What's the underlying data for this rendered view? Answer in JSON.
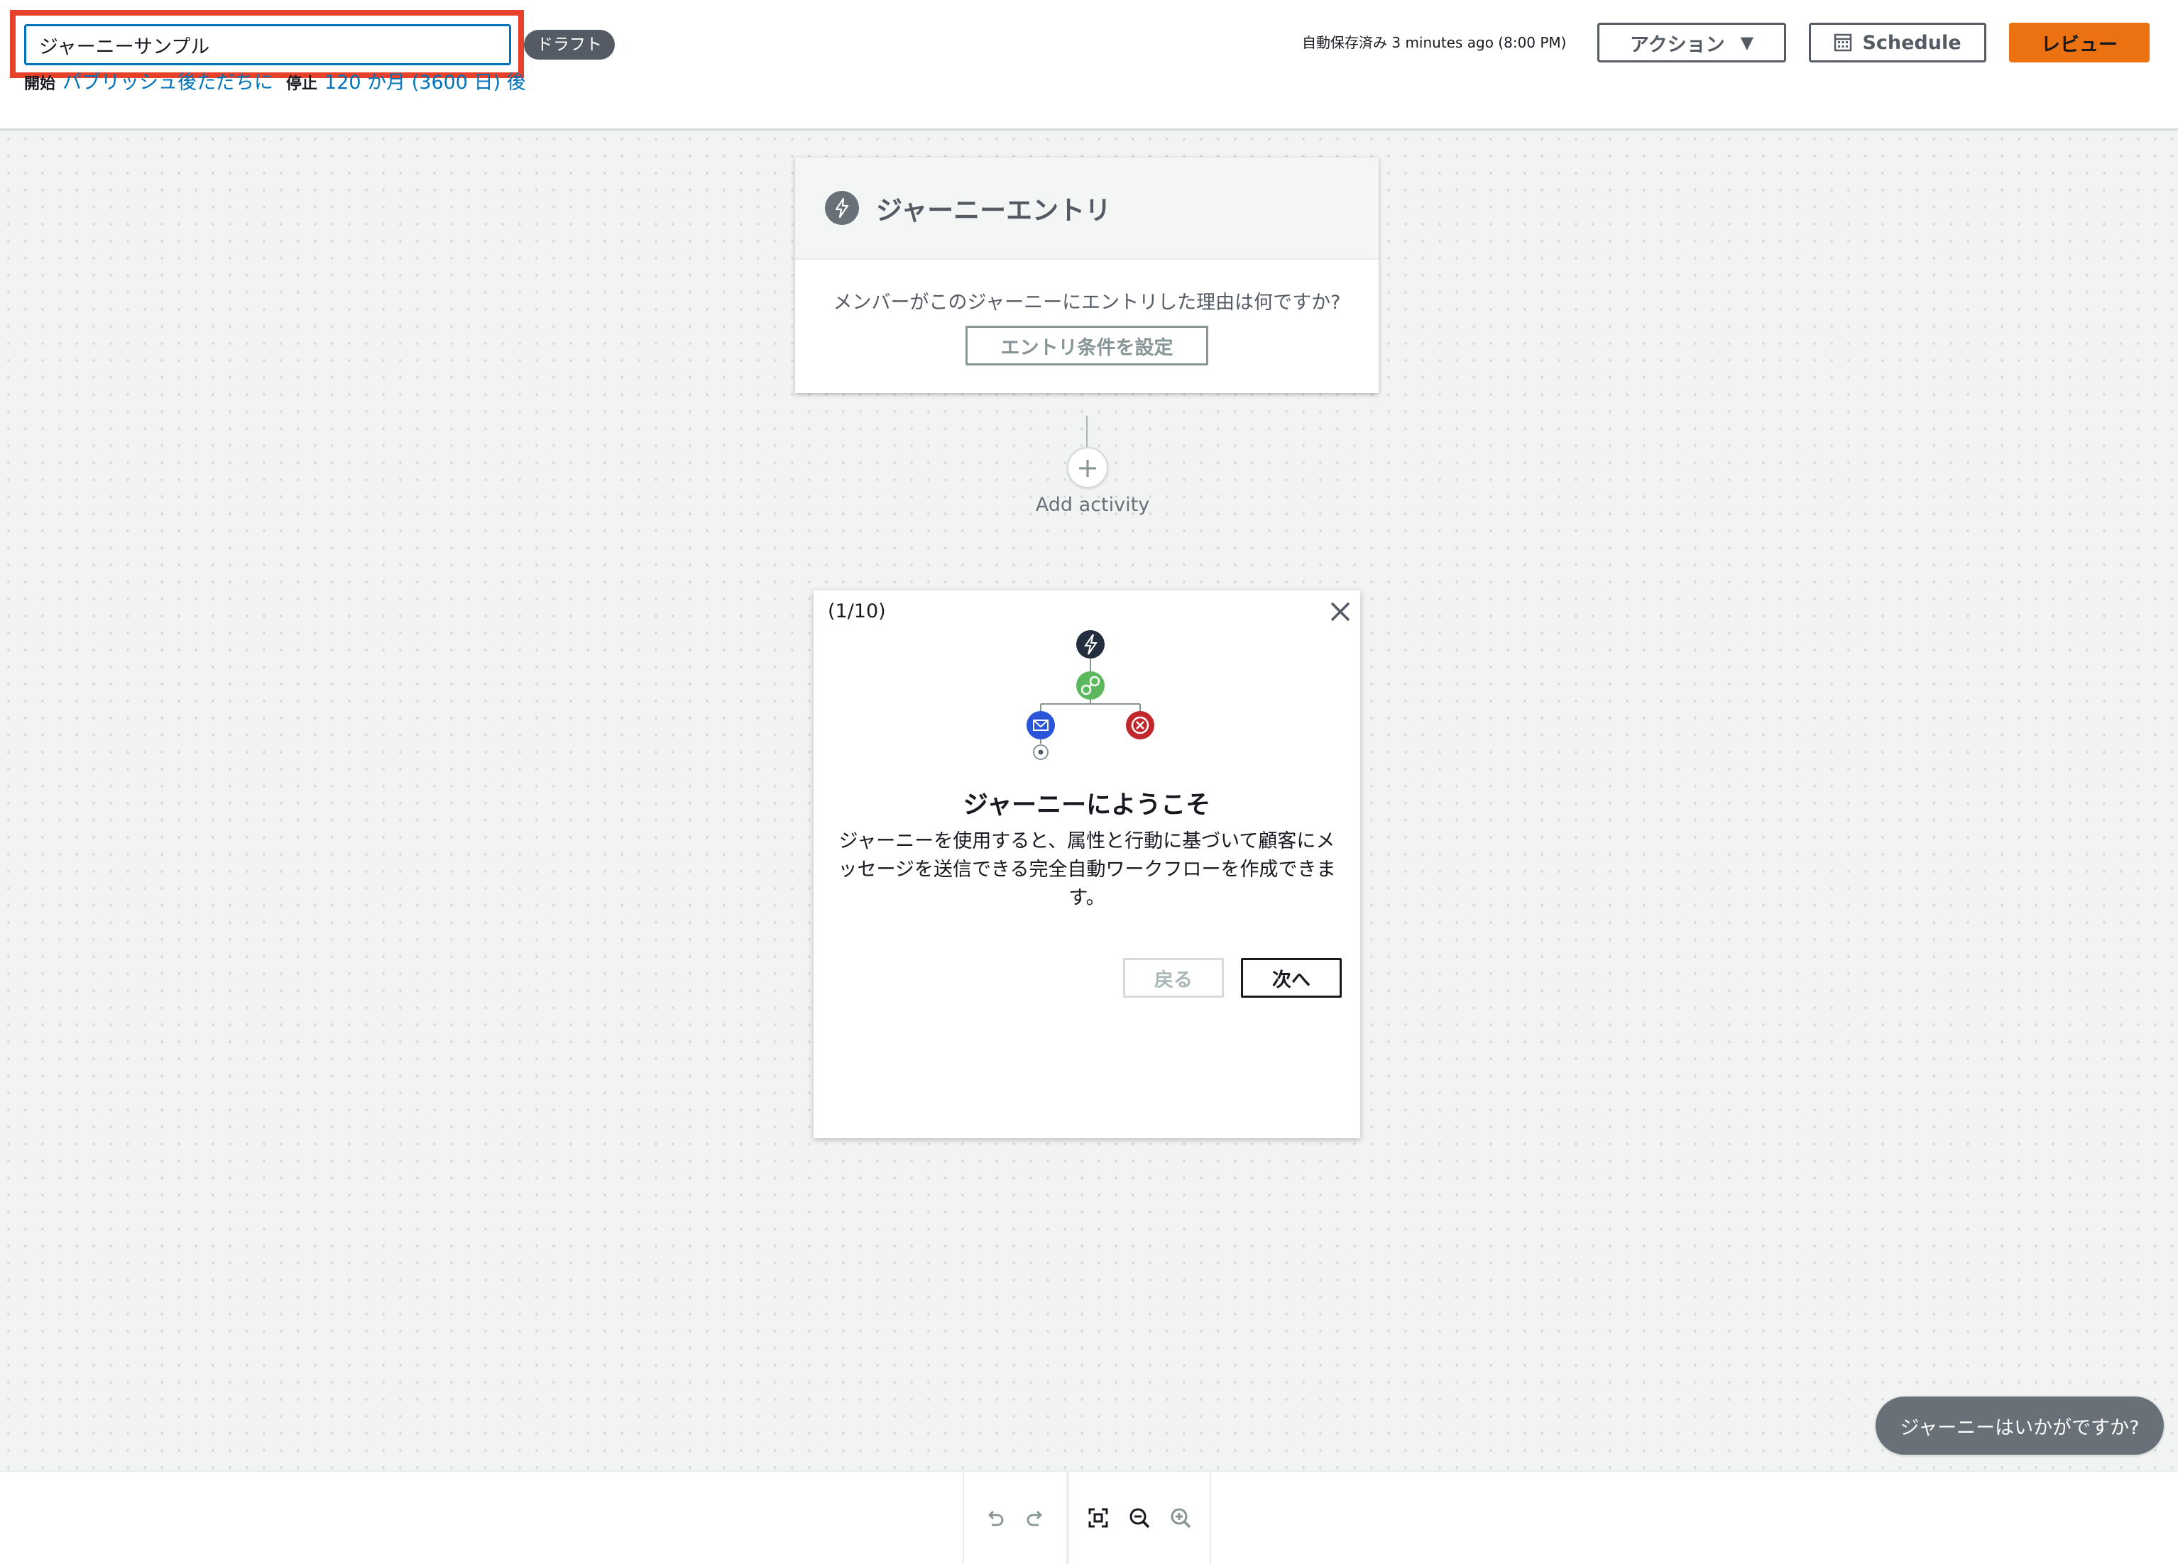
{
  "header": {
    "journey_name": "ジャーニーサンプル",
    "status_badge": "ドラフト",
    "start_label": "開始",
    "start_value": "パブリッシュ後ただちに",
    "stop_label": "停止",
    "stop_value": "120 か月 (3600 日) 後",
    "autosave_text": "自動保存済み 3 minutes ago (8:00 PM)",
    "actions_label": "アクション",
    "schedule_label": "Schedule",
    "review_label": "レビュー"
  },
  "entry_card": {
    "title": "ジャーニーエントリ",
    "question": "メンバーがこのジャーニーにエントリした理由は何ですか?",
    "condition_button": "エントリ条件を設定"
  },
  "add_activity": {
    "symbol": "+",
    "label": "Add activity"
  },
  "tour": {
    "step": "(1/10)",
    "title": "ジャーニーにようこそ",
    "description": "ジャーニーを使用すると、属性と行動に基づいて顧客にメッセージを送信できる完全自動ワークフローを作成できます。",
    "back_label": "戻る",
    "next_label": "次へ"
  },
  "feedback": {
    "label": "ジャーニーはいかがですか?"
  },
  "colors": {
    "highlight": "#e8412a",
    "primary_button": "#ec7211",
    "link": "#0073bb",
    "node_entry": "#232f3e",
    "node_split": "#5cb85c",
    "node_email": "#2b55d8",
    "node_end": "#c0282e"
  },
  "icons": [
    "bolt-icon",
    "caret-down-icon",
    "calendar-icon",
    "plus-icon",
    "close-icon",
    "undo-icon",
    "redo-icon",
    "fit-screen-icon",
    "zoom-out-icon",
    "zoom-in-icon"
  ]
}
